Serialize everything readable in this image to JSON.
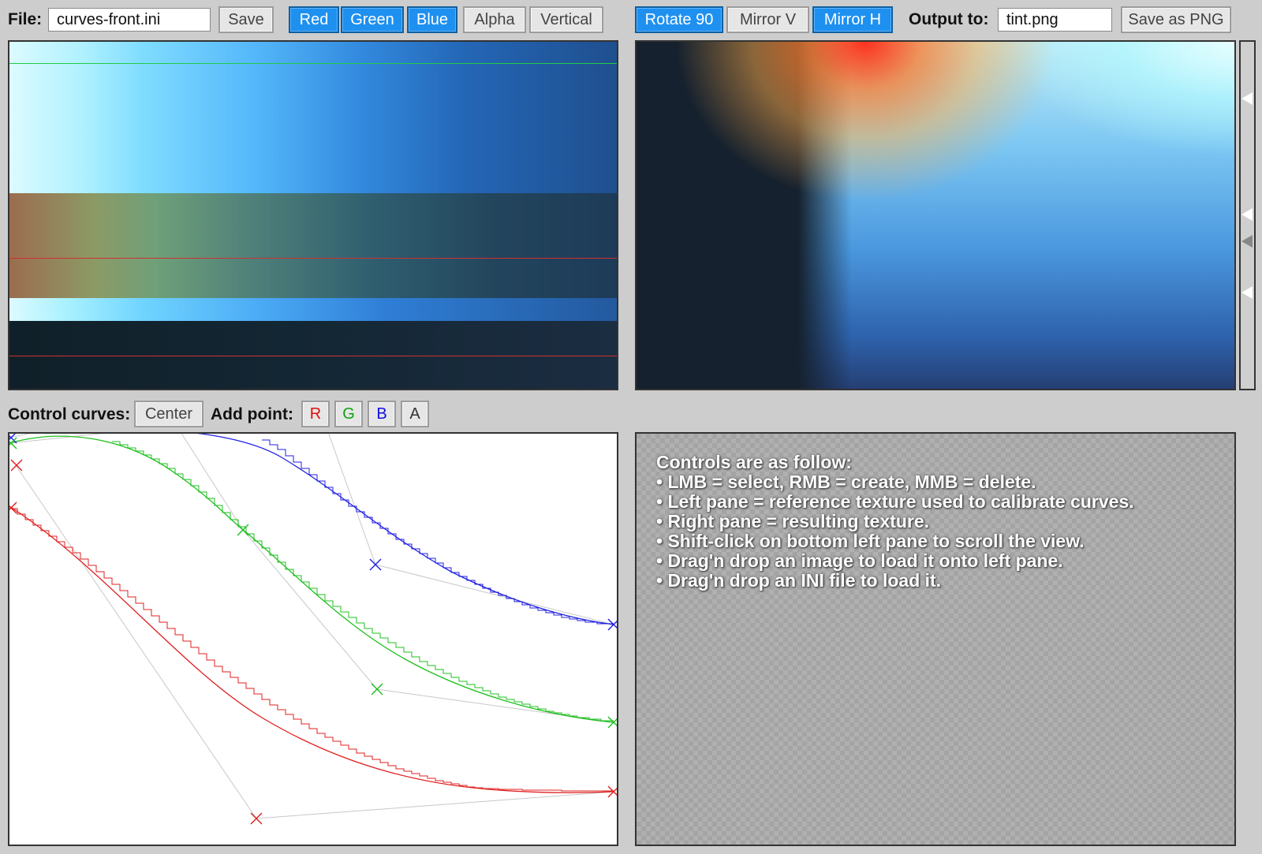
{
  "toolbar": {
    "file_label": "File:",
    "file_value": "curves-front.ini",
    "save_label": "Save",
    "channels": [
      {
        "label": "Red",
        "active": true
      },
      {
        "label": "Green",
        "active": true
      },
      {
        "label": "Blue",
        "active": true
      },
      {
        "label": "Alpha",
        "active": false
      },
      {
        "label": "Vertical",
        "active": false
      }
    ],
    "transforms": [
      {
        "label": "Rotate 90",
        "active": true
      },
      {
        "label": "Mirror V",
        "active": false
      },
      {
        "label": "Mirror H",
        "active": true
      }
    ],
    "output_label": "Output to:",
    "output_value": "tint.png",
    "save_png_label": "Save as PNG"
  },
  "curves_bar": {
    "label": "Control curves:",
    "center_label": "Center",
    "add_point_label": "Add point:",
    "points": [
      {
        "label": "R",
        "color": "#e01010"
      },
      {
        "label": "G",
        "color": "#10a010"
      },
      {
        "label": "B",
        "color": "#1010e0"
      },
      {
        "label": "A",
        "color": "#333333"
      }
    ]
  },
  "colors": {
    "active_button": "#1e90f0",
    "red_curve": "#e02020",
    "green_curve": "#20c020",
    "blue_curve": "#2020e0",
    "control_polygon": "#c8c8c8"
  },
  "help": {
    "lines": [
      "Controls are as follow:",
      "• LMB = select, RMB = create, MMB = delete.",
      "• Left pane = reference texture used to calibrate curves.",
      "• Right pane = resulting texture.",
      "• Shift-click on bottom left pane to scroll the view.",
      "• Drag'n drop an image to load it onto left pane.",
      "• Drag'n drop an INI file to load it."
    ]
  }
}
